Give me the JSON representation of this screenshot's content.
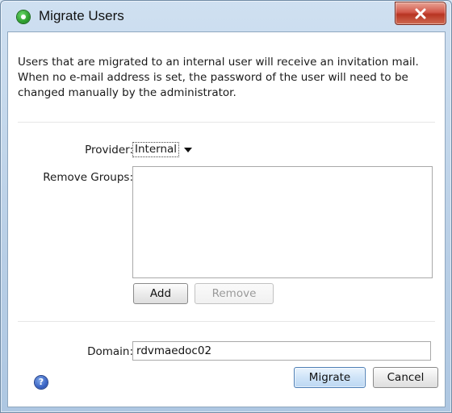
{
  "window": {
    "title": "Migrate Users",
    "app_icon": "app-logo-icon",
    "close_icon": "close-icon",
    "close_color": "#c9432f"
  },
  "description": "Users that are migrated to an internal user will receive an invitation mail. When no e-mail address is set, the password of the user will need to be changed manually by the administrator.",
  "form": {
    "provider_label": "Provider:",
    "provider_value": "Internal",
    "remove_groups_label": "Remove Groups:",
    "remove_groups_items": [],
    "add_label": "Add",
    "remove_label": "Remove",
    "domain_label": "Domain:",
    "domain_value": "rdvmaedoc02"
  },
  "footer": {
    "help_icon": "help-icon",
    "migrate_label": "Migrate",
    "cancel_label": "Cancel"
  }
}
